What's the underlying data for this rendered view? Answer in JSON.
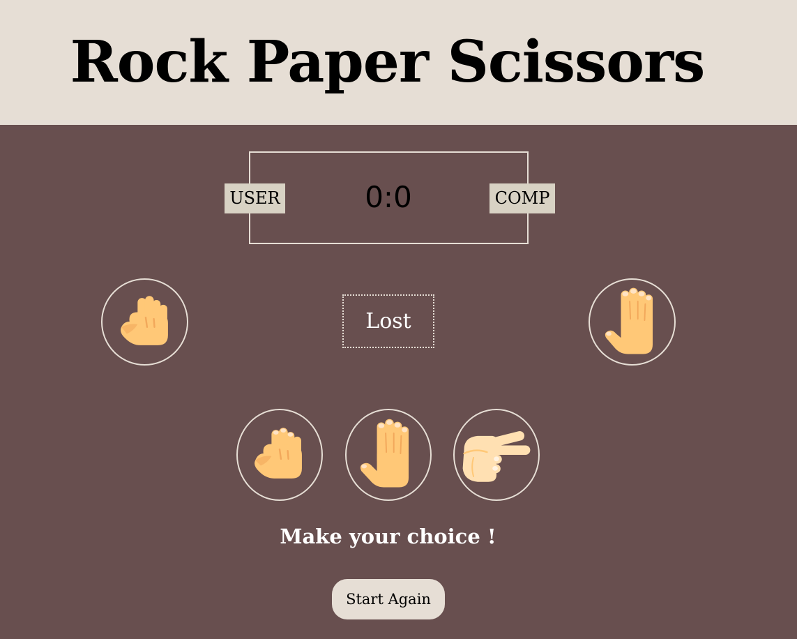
{
  "header": {
    "title": "Rock Paper Scissors"
  },
  "scoreboard": {
    "user_label": "USER",
    "comp_label": "COMP",
    "score": "0:0"
  },
  "round": {
    "user_pick_icon": "rock-hand-icon",
    "comp_pick_icon": "paper-hand-icon",
    "result": "Lost"
  },
  "choices": [
    {
      "name": "rock",
      "icon": "rock-hand-icon"
    },
    {
      "name": "paper",
      "icon": "paper-hand-icon"
    },
    {
      "name": "scissors",
      "icon": "scissors-hand-icon"
    }
  ],
  "message": "Make your choice !",
  "restart_label": "Start Again",
  "colors": {
    "background": "#684f4f",
    "header_bg": "#e6ded5",
    "tag_bg": "#d8d2c4",
    "skin": "#ffc877",
    "skin_shade": "#f2a85b",
    "nail": "#ffe3c4"
  }
}
